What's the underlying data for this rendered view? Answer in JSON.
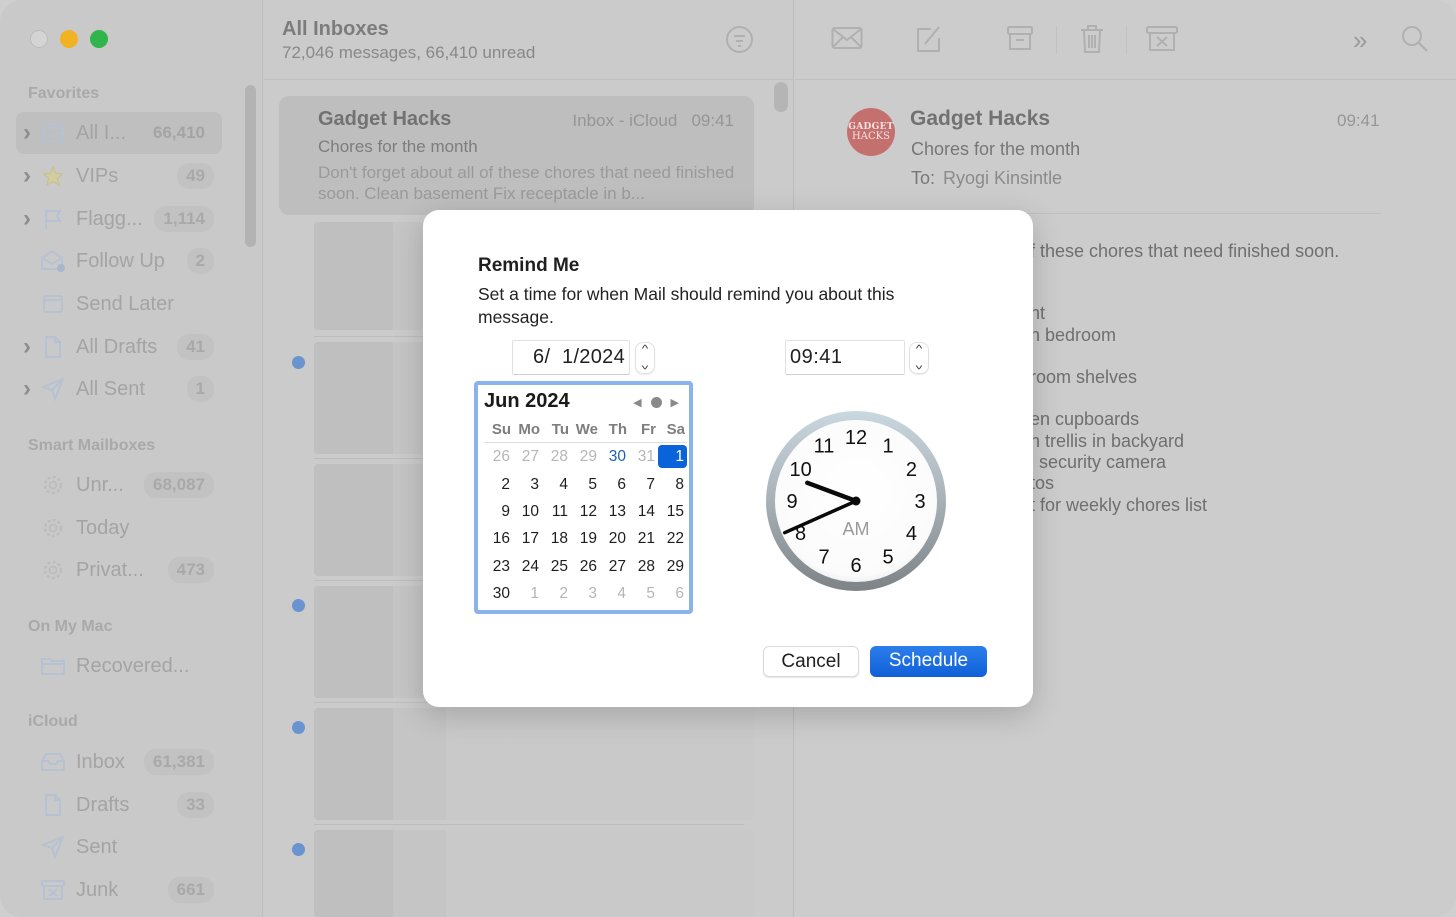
{
  "window": {
    "traffic_lights": [
      "close",
      "minimize",
      "zoom"
    ]
  },
  "sidebar": {
    "sections": [
      {
        "title": "Favorites",
        "items": [
          {
            "label": "All I...",
            "icon": "tray-icon",
            "badge": "66,410",
            "chevron": true,
            "selected": true
          },
          {
            "label": "VIPs",
            "icon": "star-icon",
            "badge": "49",
            "chevron": true
          },
          {
            "label": "Flagg...",
            "icon": "flag-icon",
            "badge": "1,114",
            "chevron": true
          },
          {
            "label": "Follow Up",
            "icon": "envelope-open-icon",
            "badge": "2",
            "chevron": false
          },
          {
            "label": "Send Later",
            "icon": "calendar-icon",
            "badge": "",
            "chevron": false
          },
          {
            "label": "All Drafts",
            "icon": "document-icon",
            "badge": "41",
            "chevron": true
          },
          {
            "label": "All Sent",
            "icon": "paperplane-icon",
            "badge": "1",
            "chevron": true
          }
        ]
      },
      {
        "title": "Smart Mailboxes",
        "items": [
          {
            "label": "Unr...",
            "icon": "gear-icon",
            "badge": "68,087"
          },
          {
            "label": "Today",
            "icon": "gear-icon",
            "badge": ""
          },
          {
            "label": "Privat...",
            "icon": "gear-icon",
            "badge": "473"
          }
        ]
      },
      {
        "title": "On My Mac",
        "items": [
          {
            "label": "Recovered...",
            "icon": "folder-icon",
            "badge": ""
          }
        ]
      },
      {
        "title": "iCloud",
        "items": [
          {
            "label": "Inbox",
            "icon": "inbox-icon",
            "badge": "61,381"
          },
          {
            "label": "Drafts",
            "icon": "document-icon",
            "badge": "33"
          },
          {
            "label": "Sent",
            "icon": "paperplane-icon",
            "badge": ""
          },
          {
            "label": "Junk",
            "icon": "junk-icon",
            "badge": "661"
          }
        ]
      }
    ]
  },
  "message_list": {
    "title": "All Inboxes",
    "subtitle": "72,046 messages, 66,410 unread",
    "selected_message": {
      "from": "Gadget Hacks",
      "mailbox": "Inbox - iCloud",
      "time": "09:41",
      "subject": "Chores for the month",
      "preview": "Don't forget about all of these chores that need finished soon. Clean basement Fix receptacle in b..."
    }
  },
  "toolbar": {
    "buttons": [
      "get-mail-icon",
      "compose-icon",
      "archive-icon",
      "trash-icon",
      "junk-icon",
      "more-icon",
      "search-icon"
    ]
  },
  "reader": {
    "avatar_line1": "GADGET",
    "avatar_line2": "HACKS",
    "avatar_color": "#c4706e",
    "from": "Gadget Hacks",
    "time": "09:41",
    "subject": "Chores for the month",
    "to_label": "To:",
    "to": "Ryogi Kinsintle",
    "body_visible_fragments": [
      "f these chores that need finished soon.",
      "nt",
      "n bedroom",
      "room shelves",
      "en cupboards",
      "n trellis in backyard",
      "l security camera",
      "tos",
      "t for weekly chores list"
    ]
  },
  "dialog": {
    "title": "Remind Me",
    "description": "Set a time for when Mail should remind you about this message.",
    "date_value": "6/  1/2024",
    "time_value": "09:41",
    "calendar": {
      "month_label": "Jun 2024",
      "weekdays": [
        "Su",
        "Mo",
        "Tu",
        "We",
        "Th",
        "Fr",
        "Sa"
      ],
      "weeks": [
        [
          {
            "d": "26",
            "o": true
          },
          {
            "d": "27",
            "o": true
          },
          {
            "d": "28",
            "o": true
          },
          {
            "d": "29",
            "o": true
          },
          {
            "d": "30",
            "t": true
          },
          {
            "d": "31",
            "o": true
          },
          {
            "d": "1",
            "s": true
          }
        ],
        [
          {
            "d": "2"
          },
          {
            "d": "3"
          },
          {
            "d": "4"
          },
          {
            "d": "5"
          },
          {
            "d": "6"
          },
          {
            "d": "7"
          },
          {
            "d": "8"
          }
        ],
        [
          {
            "d": "9"
          },
          {
            "d": "10"
          },
          {
            "d": "11"
          },
          {
            "d": "12"
          },
          {
            "d": "13"
          },
          {
            "d": "14"
          },
          {
            "d": "15"
          }
        ],
        [
          {
            "d": "16"
          },
          {
            "d": "17"
          },
          {
            "d": "18"
          },
          {
            "d": "19"
          },
          {
            "d": "20"
          },
          {
            "d": "21"
          },
          {
            "d": "22"
          }
        ],
        [
          {
            "d": "23"
          },
          {
            "d": "24"
          },
          {
            "d": "25"
          },
          {
            "d": "26"
          },
          {
            "d": "27"
          },
          {
            "d": "28"
          },
          {
            "d": "29"
          }
        ],
        [
          {
            "d": "30"
          },
          {
            "d": "1",
            "o": true
          },
          {
            "d": "2",
            "o": true
          },
          {
            "d": "3",
            "o": true
          },
          {
            "d": "4",
            "o": true
          },
          {
            "d": "5",
            "o": true
          },
          {
            "d": "6",
            "o": true
          }
        ]
      ],
      "selected_color": "#0a63d8"
    },
    "clock": {
      "hour": 9,
      "minute": 41,
      "meridiem": "AM",
      "numbers": [
        "12",
        "1",
        "2",
        "3",
        "4",
        "5",
        "6",
        "7",
        "8",
        "9",
        "10",
        "11"
      ]
    },
    "cancel_label": "Cancel",
    "schedule_label": "Schedule",
    "accent": "#1a6ee0"
  }
}
